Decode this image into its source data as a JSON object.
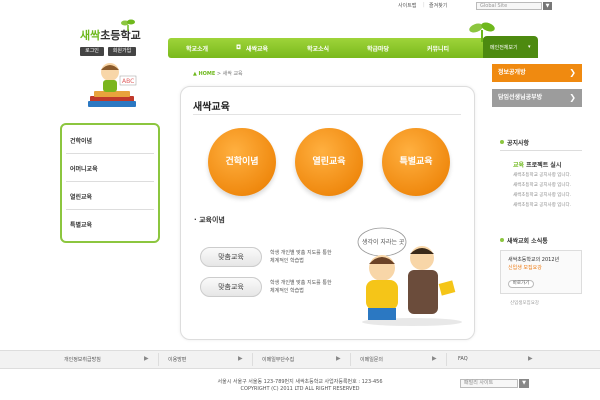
{
  "topbar": {
    "sitemap": "사이트맵",
    "favorite": "즐겨찾기",
    "global_site": "Global Site",
    "go_arrow": "▼"
  },
  "logo": {
    "highlight": "새싹",
    "name": "초등학교",
    "login": "로그인",
    "join": "회원가입"
  },
  "nav": {
    "items": [
      "학교소개",
      "새싹교육",
      "학교소식",
      "학급마당",
      "커뮤니티"
    ],
    "home_label": "메인전체보기",
    "home_arrow": "▾",
    "bullet": "◘"
  },
  "breadcrumb": {
    "home": "HOME",
    "separator": ">",
    "current": "새싹 교육",
    "home_icon": "▲"
  },
  "banners": [
    {
      "label": "정보공개방",
      "color": "#f08a10",
      "arrow": "❯"
    },
    {
      "label": "담임선생님공부방",
      "color": "#9c9c9c",
      "arrow": "❯"
    }
  ],
  "submenu": {
    "items": [
      "건학이념",
      "어머니교육",
      "열린교육",
      "특별교육"
    ]
  },
  "main": {
    "title": "새싹교육",
    "circles": [
      "건학이념",
      "열린교육",
      "특별교육"
    ],
    "section_bullet": "·",
    "section_title": "교육이념",
    "illustration_text": "생각이 자라는 곳",
    "rows": [
      {
        "label": "맞춤교육",
        "desc1": "학생 개인별 맞춤 지도를 통한",
        "desc2": "체계적인 학습법"
      },
      {
        "label": "맞춤교육",
        "desc1": "학생 개인별 맞춤 지도를 통한",
        "desc2": "체계적인 학습법"
      }
    ]
  },
  "sidebar": {
    "notice_title": "공지사항",
    "notice_feature_hl": "교육",
    "notice_feature": " 프로젝트 실시",
    "notice_items": [
      "새싹초등학교 공지사항 입니다.",
      "새싹초등학교 공지사항 입니다.",
      "새싹초등학교 공지사항 입니다.",
      "새싹초등학교 공지사항 입니다."
    ],
    "news_title": "새싹교회 소식통",
    "news_line1": "새싹초등학교의 2012년",
    "news_line2": "신입생 모집요강",
    "news_btn": "바로가기",
    "news_footer": "신입생모집요강"
  },
  "footer": {
    "links": [
      "개인정보취급방침",
      "이용방편",
      "이메일무단수집",
      "이메일문의",
      "FAQ"
    ],
    "arrow": "▶",
    "address": "서울시 서울구 서울동 123-789번지 새싹초등학교 사업자등록번호 : 123-456",
    "copyright": "COPYRIGHT (C) 2011 LTD ALL RIGHT RESERVED",
    "family_site": "패밀리 사이트",
    "family_arrow": "▼"
  },
  "colors": {
    "green": "#8cc63f",
    "orange": "#f08a10",
    "gray": "#9c9c9c"
  }
}
